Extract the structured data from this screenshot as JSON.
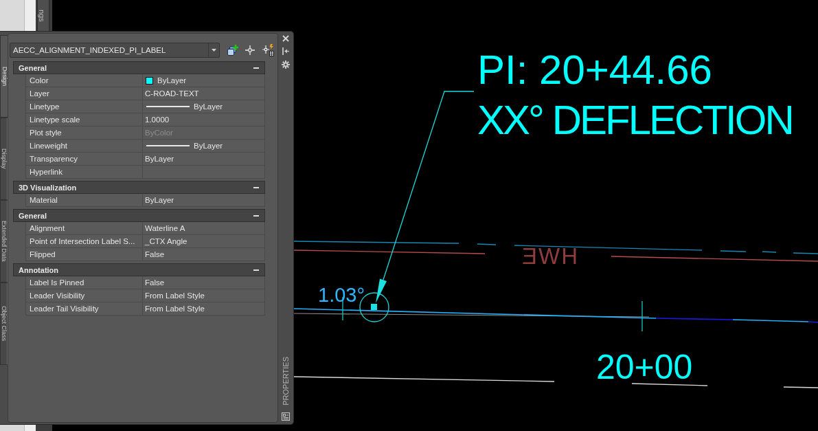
{
  "background_window": {
    "tab_label": "ngs"
  },
  "palette": {
    "title": "PROPERTIES",
    "side_tabs": [
      {
        "label": "Design",
        "selected": true
      },
      {
        "label": "Display",
        "selected": false
      },
      {
        "label": "Extended Data",
        "selected": false
      },
      {
        "label": "Object Class",
        "selected": false
      }
    ],
    "object_type": "AECC_ALIGNMENT_INDEXED_PI_LABEL",
    "categories": [
      {
        "name": "General",
        "expanded": true,
        "properties": [
          {
            "label": "Color",
            "kind": "swatch",
            "value": "ByLayer",
            "color": "#00ffff",
            "disabled": false
          },
          {
            "label": "Layer",
            "kind": "text",
            "value": "C-ROAD-TEXT",
            "disabled": false
          },
          {
            "label": "Linetype",
            "kind": "line",
            "value": "ByLayer",
            "disabled": false
          },
          {
            "label": "Linetype scale",
            "kind": "text",
            "value": "1.0000",
            "disabled": false
          },
          {
            "label": "Plot style",
            "kind": "text",
            "value": "ByColor",
            "disabled": true
          },
          {
            "label": "Lineweight",
            "kind": "line",
            "value": "ByLayer",
            "disabled": false
          },
          {
            "label": "Transparency",
            "kind": "text",
            "value": "ByLayer",
            "disabled": false
          },
          {
            "label": "Hyperlink",
            "kind": "text"
          }
        ]
      },
      {
        "name": "3D Visualization",
        "expanded": true,
        "properties": [
          {
            "label": "Material",
            "kind": "text",
            "value": "ByLayer",
            "disabled": false
          }
        ]
      },
      {
        "name": "General",
        "expanded": true,
        "properties": [
          {
            "label": "Alignment",
            "kind": "text",
            "value": "Waterline A",
            "disabled": false
          },
          {
            "label": "Point of Intersection Label S...",
            "kind": "text",
            "value": "_CTX Angle",
            "disabled": false
          },
          {
            "label": "Flipped",
            "kind": "text",
            "value": "False",
            "disabled": false
          }
        ]
      },
      {
        "name": "Annotation",
        "expanded": true,
        "properties": [
          {
            "label": "Label Is Pinned",
            "kind": "text",
            "value": "False",
            "disabled": false
          },
          {
            "label": "Leader Visibility",
            "kind": "text",
            "value": "From Label Style",
            "disabled": false
          },
          {
            "label": "Leader Tail Visibility",
            "kind": "text",
            "value": "From Label Style",
            "disabled": false
          }
        ]
      }
    ]
  },
  "drawing": {
    "pi_label": [
      "PI: 20+44.66",
      "XX° DEFLECTION"
    ],
    "angle_label": "1.03°",
    "station_label": "20+00",
    "reversed_label": "ƎWH"
  }
}
